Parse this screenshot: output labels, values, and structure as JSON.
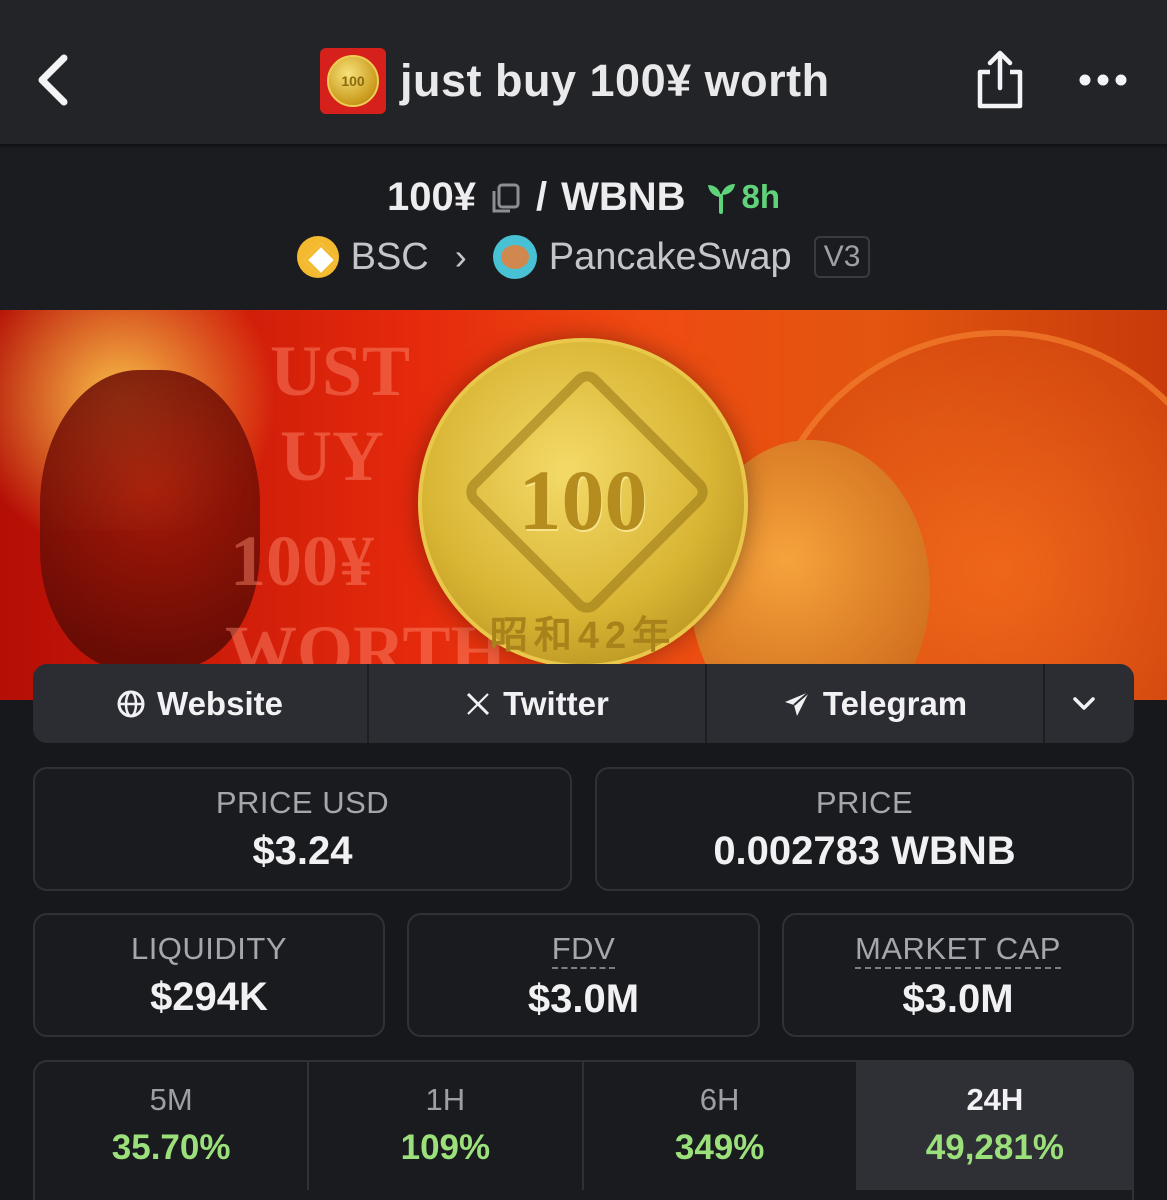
{
  "header": {
    "title": "just buy 100¥ worth",
    "logo_text": "100"
  },
  "pair": {
    "base": "100¥",
    "separator": "/",
    "quote": "WBNB",
    "age": "8h",
    "chain": "BSC",
    "dex": "PancakeSwap",
    "dex_version": "V3"
  },
  "banner": {
    "coin_value": "100",
    "coin_era": "昭和42年",
    "word1": "UST",
    "word2": "UY",
    "word3": "100¥",
    "word4": "WORTH"
  },
  "links": {
    "website": "Website",
    "twitter": "Twitter",
    "telegram": "Telegram"
  },
  "stats": {
    "price_usd_label": "PRICE USD",
    "price_usd": "$3.24",
    "price_label": "PRICE",
    "price": "0.002783 WBNB",
    "liquidity_label": "LIQUIDITY",
    "liquidity": "$294K",
    "fdv_label": "FDV",
    "fdv": "$3.0M",
    "mcap_label": "MARKET CAP",
    "mcap": "$3.0M"
  },
  "timeframes": [
    {
      "label": "5M",
      "change": "35.70%"
    },
    {
      "label": "1H",
      "change": "109%"
    },
    {
      "label": "6H",
      "change": "349%"
    },
    {
      "label": "24H",
      "change": "49,281%"
    }
  ],
  "colors": {
    "background": "#17181c",
    "positive": "#9be07a",
    "age_green": "#5fd37a"
  }
}
